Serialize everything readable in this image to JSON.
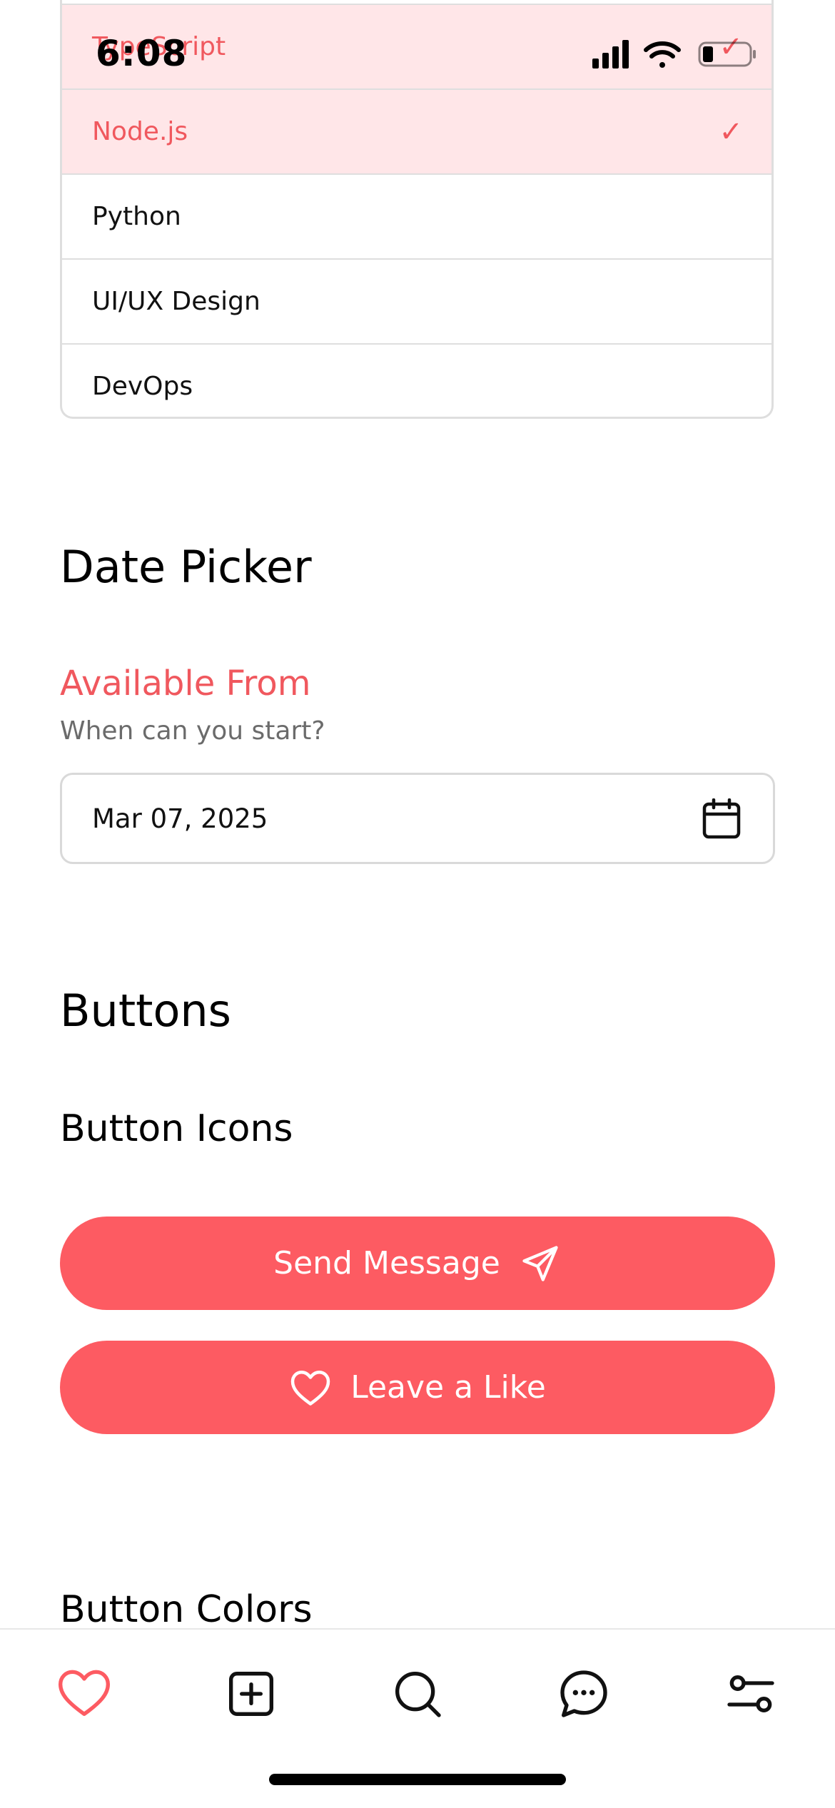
{
  "status_bar": {
    "time": "6:08"
  },
  "select_options": [
    {
      "label": "TypeScript",
      "selected": true
    },
    {
      "label": "Node.js",
      "selected": true
    },
    {
      "label": "Python",
      "selected": false
    },
    {
      "label": "UI/UX Design",
      "selected": false
    },
    {
      "label": "DevOps",
      "selected": false
    }
  ],
  "date_picker": {
    "section_title": "Date Picker",
    "label": "Available From",
    "hint": "When can you start?",
    "value": "Mar 07, 2025"
  },
  "buttons": {
    "section_title": "Buttons",
    "icons_subtitle": "Button Icons",
    "send_label": "Send Message",
    "like_label": "Leave a Like",
    "colors_subtitle": "Button Colors"
  },
  "tabbar": {
    "tabs": [
      {
        "icon": "heart-icon",
        "active": true
      },
      {
        "icon": "plus-square-icon",
        "active": false
      },
      {
        "icon": "search-icon",
        "active": false
      },
      {
        "icon": "chat-icon",
        "active": false
      },
      {
        "icon": "sliders-icon",
        "active": false
      }
    ]
  },
  "colors": {
    "accent": "#fd5b62",
    "selected_bg": "#ffe6e8",
    "text": "#111111",
    "hint": "#6b6b6b"
  }
}
